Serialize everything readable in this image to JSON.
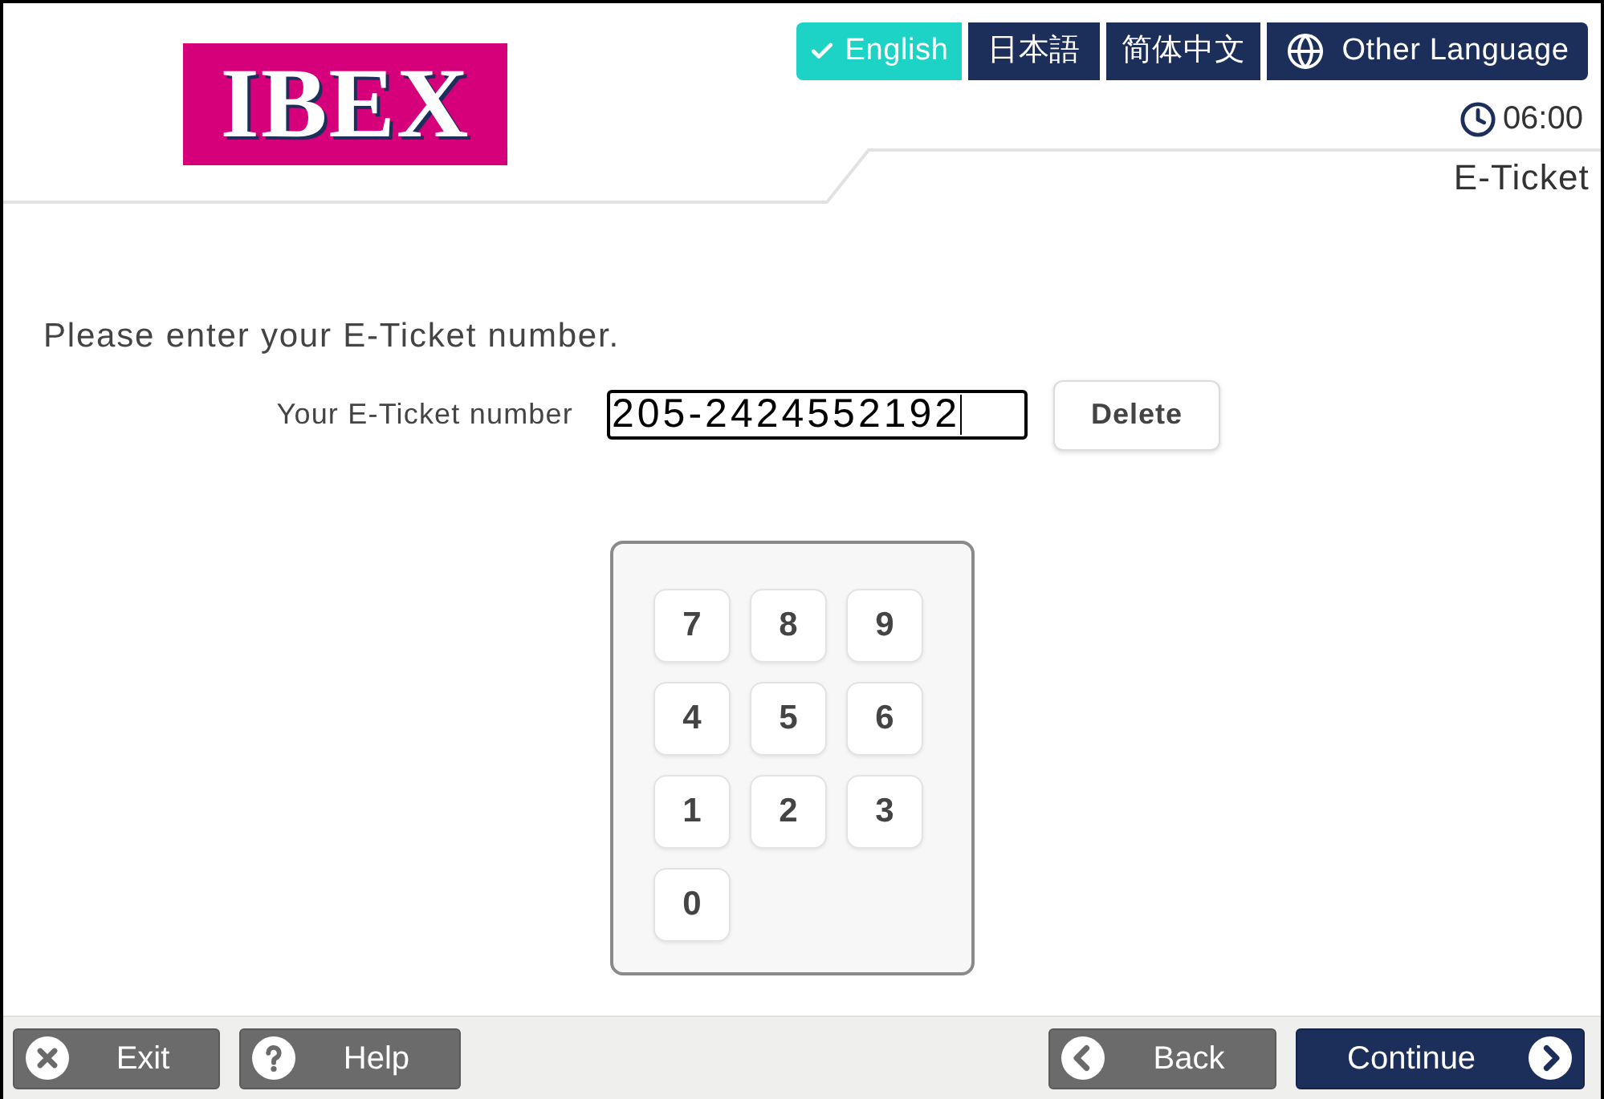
{
  "header": {
    "logo": "IBEX",
    "languages": [
      {
        "label": "English",
        "kind": "language",
        "selected": true
      },
      {
        "label": "日本語",
        "kind": "language",
        "selected": false
      },
      {
        "label": "简体中文",
        "kind": "language",
        "selected": false
      },
      {
        "label": "Other Language",
        "kind": "more",
        "selected": false
      }
    ],
    "timer": "06:00",
    "page_title": "E-Ticket"
  },
  "instruction": "Please enter your E-Ticket number.",
  "ticket_field": {
    "label": "Your E-Ticket number",
    "value": "205-2424552192"
  },
  "delete_button": "Delete",
  "keypad": [
    "7",
    "8",
    "9",
    "4",
    "5",
    "6",
    "1",
    "2",
    "3",
    "0"
  ],
  "footer": {
    "left": [
      {
        "label": "Exit",
        "kind": "exit"
      },
      {
        "label": "Help",
        "kind": "help"
      }
    ],
    "right": [
      {
        "label": "Back",
        "kind": "back"
      },
      {
        "label": "Continue",
        "kind": "continue"
      }
    ]
  }
}
